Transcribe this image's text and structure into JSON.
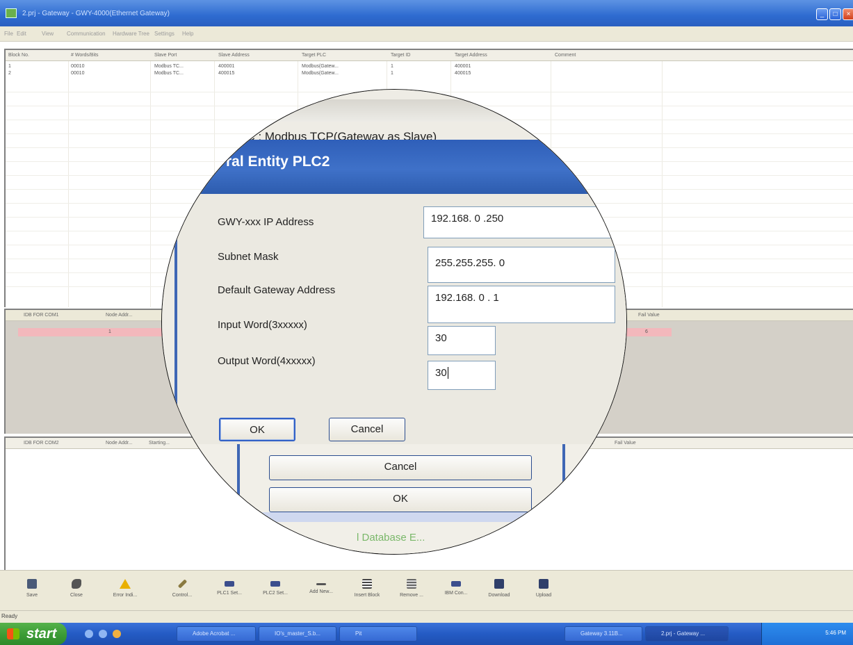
{
  "window": {
    "title": "2.prj - Gateway - GWY-4000(Ethernet Gateway)",
    "menu": [
      "File",
      "Edit",
      "View",
      "Communication",
      "Hardware Tree",
      "Settings",
      "Help"
    ]
  },
  "block_table": {
    "columns": [
      "Block No.",
      "# Words/Bits",
      "Slave Port",
      "Slave Address",
      "Target PLC",
      "Target ID",
      "Target Address",
      "Comment"
    ],
    "rows": [
      [
        "1",
        "00010",
        "Modbus TC...",
        "400001",
        "Modbus(Gatew...",
        "1",
        "400001",
        ""
      ],
      [
        "2",
        "00010",
        "Modbus TC...",
        "400015",
        "Modbus(Gatew...",
        "1",
        "400015",
        ""
      ]
    ]
  },
  "com1_table": {
    "columns": [
      "IDB FOR COM1",
      "Node Addr...",
      "Fail Value"
    ],
    "row": [
      "",
      "1",
      "6"
    ]
  },
  "com2_table": {
    "columns": [
      "IDB FOR COM2",
      "Node Addr...",
      "Starting...",
      "...",
      "Fail Value"
    ]
  },
  "toolbar": {
    "items": [
      {
        "label": "Save",
        "icon": "save-icon"
      },
      {
        "label": "Close",
        "icon": "close-file-icon"
      },
      {
        "label": "Error Indi...",
        "icon": "warning-icon"
      },
      {
        "label": "Control...",
        "icon": "wrench-icon"
      },
      {
        "label": "PLC1 Set...",
        "icon": "plc-icon"
      },
      {
        "label": "PLC2 Set...",
        "icon": "plc-icon"
      },
      {
        "label": "Add New...",
        "icon": "add-block-icon"
      },
      {
        "label": "Insert Block",
        "icon": "insert-block-icon"
      },
      {
        "label": "Remove ...",
        "icon": "remove-block-icon"
      },
      {
        "label": "IBM Con...",
        "icon": "plc-icon"
      },
      {
        "label": "Download",
        "icon": "download-icon"
      },
      {
        "label": "Upload",
        "icon": "upload-icon"
      }
    ]
  },
  "status": "Ready",
  "taskbar": {
    "start": "start",
    "tasks": [
      "Adobe Acrobat ...",
      "IO's_master_S.b...",
      "Pit",
      "Gateway 3.11B...",
      "2.prj - Gateway ..."
    ],
    "clock": "5:46 PM"
  },
  "magnifier": {
    "plc_label": "LC :  Modbus TCP(Gateway as Slave)",
    "dialog_title": "ral Entity PLC2",
    "fields": {
      "ip_label": "GWY-xxx IP Address",
      "ip_value": "192.168.  0  .250",
      "subnet_label": "Subnet Mask",
      "subnet_value": "255.255.255.  0",
      "gateway_label": "Default Gateway Address",
      "gateway_value": "192.168.  0  .  1",
      "input_label": "Input Word(3xxxxx)",
      "input_value": "30",
      "output_label": "Output Word(4xxxxx)",
      "output_value": "30"
    },
    "ok": "OK",
    "cancel": "Cancel",
    "lower_cancel": "Cancel",
    "lower_ok": "OK",
    "lower_text": "l Database E..."
  }
}
